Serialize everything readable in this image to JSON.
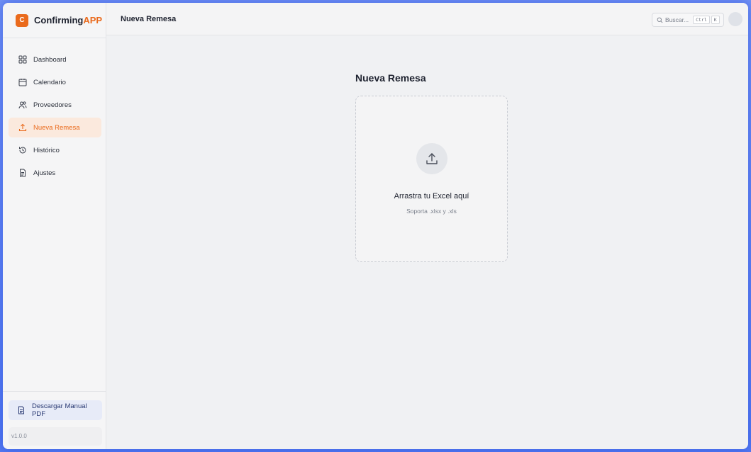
{
  "app": {
    "badge_letter": "C",
    "name_part1": "Confirming",
    "name_part2": "APP",
    "accent_color": "#ea6a1c"
  },
  "sidebar": {
    "items": [
      {
        "label": "Dashboard",
        "icon": "grid-icon"
      },
      {
        "label": "Calendario",
        "icon": "calendar-icon"
      },
      {
        "label": "Proveedores",
        "icon": "users-icon"
      },
      {
        "label": "Nueva Remesa",
        "icon": "upload-icon",
        "active": true
      },
      {
        "label": "Histórico",
        "icon": "history-icon"
      },
      {
        "label": "Ajustes",
        "icon": "document-icon"
      }
    ],
    "manual_button": "Descargar Manual PDF",
    "version": "v1.0.0"
  },
  "header": {
    "title": "Nueva Remesa",
    "search_placeholder": "Buscar...",
    "shortcut_key1": "Ctrl",
    "shortcut_key2": "K"
  },
  "main": {
    "heading": "Nueva Remesa",
    "dropzone_title": "Arrastra tu Excel aquí",
    "dropzone_subtitle": "Soporta .xlsx y .xls"
  }
}
